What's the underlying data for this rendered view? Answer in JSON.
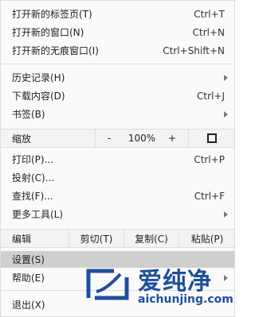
{
  "menu": {
    "group1": [
      {
        "label": "打开新的标签页(T)",
        "shortcut": "Ctrl+T"
      },
      {
        "label": "打开新的窗口(N)",
        "shortcut": "Ctrl+N"
      },
      {
        "label": "打开新的无痕窗口(I)",
        "shortcut": "Ctrl+Shift+N"
      }
    ],
    "group2": [
      {
        "label": "历史记录(H)",
        "submenu": true
      },
      {
        "label": "下载内容(D)",
        "shortcut": "Ctrl+J"
      },
      {
        "label": "书签(B)",
        "submenu": true
      }
    ],
    "zoom": {
      "label": "缩放",
      "minus": "-",
      "value": "100%",
      "plus": "+"
    },
    "group3": [
      {
        "label": "打印(P)...",
        "shortcut": "Ctrl+P"
      },
      {
        "label": "投射(C)..."
      },
      {
        "label": "查找(F)...",
        "shortcut": "Ctrl+F"
      },
      {
        "label": "更多工具(L)",
        "submenu": true
      }
    ],
    "edit": {
      "label": "编辑",
      "cut": "剪切(T)",
      "copy": "复制(C)",
      "paste": "粘贴(P)"
    },
    "group4": [
      {
        "label": "设置(S)",
        "highlighted": true
      },
      {
        "label": "帮助(E)",
        "submenu": true
      }
    ],
    "exit": {
      "label": "退出(X)"
    }
  },
  "watermark": {
    "text_cn": "爱纯净",
    "url": "aichunjing.com",
    "color": "#1d4f9c"
  },
  "colors": {
    "highlight": "#cfcfcf",
    "menu_bg": "#fafafa",
    "arrow": "#7a7a7a"
  }
}
